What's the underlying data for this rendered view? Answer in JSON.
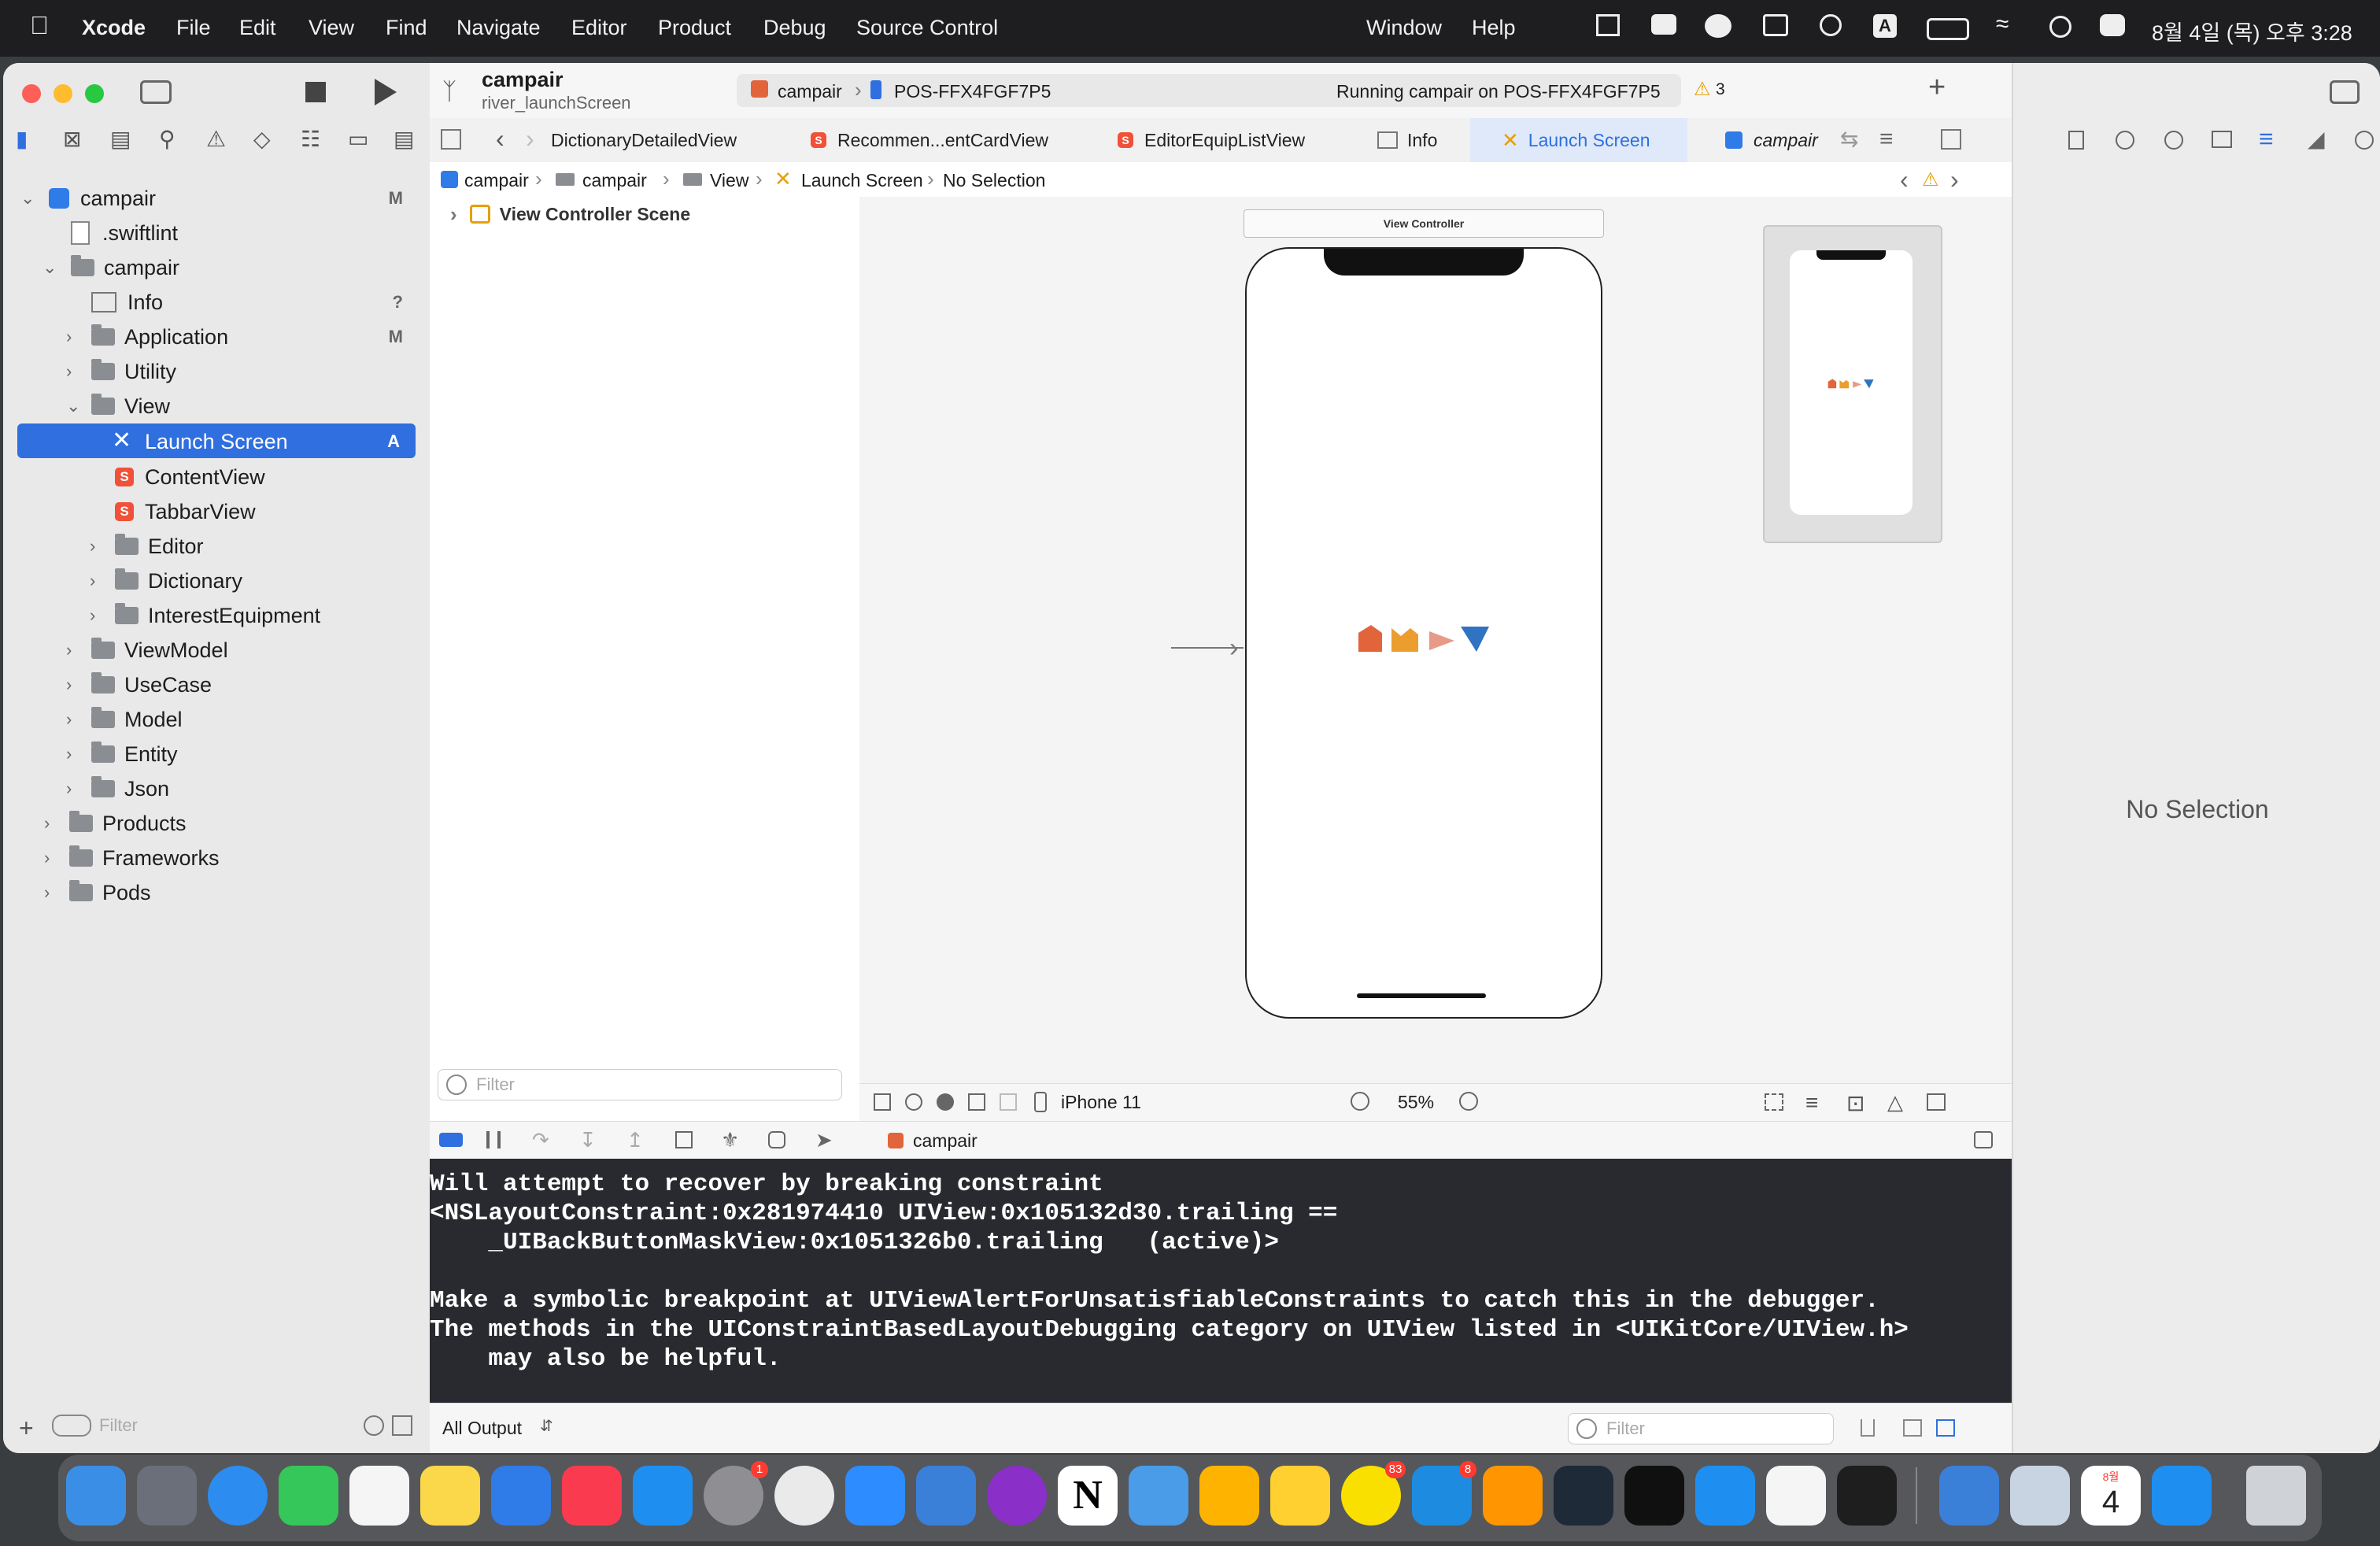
{
  "menubar": {
    "app": "Xcode",
    "items": [
      "File",
      "Edit",
      "View",
      "Find",
      "Navigate",
      "Editor",
      "Product",
      "Debug",
      "Source Control",
      "Window",
      "Help"
    ],
    "clock": "8월 4일 (목) 오후 3:28"
  },
  "toolbar": {
    "project": "campair",
    "branch": "river_launchScreen",
    "scheme": "campair",
    "device": "POS-FFX4FGF7P5",
    "status": "Running campair on POS-FFX4FGF7P5",
    "warnings": "3"
  },
  "tabs": [
    "DictionaryDetailedView",
    "Recommen...entCardView",
    "EditorEquipListView",
    "Info",
    "Launch Screen",
    "campair"
  ],
  "jumpbar": [
    "campair",
    "campair",
    "View",
    "Launch Screen",
    "No Selection"
  ],
  "navigator": {
    "items": [
      {
        "label": "campair",
        "badge": "M"
      },
      {
        "label": ".swiftlint",
        "badge": ""
      },
      {
        "label": "campair",
        "badge": ""
      },
      {
        "label": "Info",
        "badge": "?"
      },
      {
        "label": "Application",
        "badge": "M"
      },
      {
        "label": "Utility",
        "badge": ""
      },
      {
        "label": "View",
        "badge": ""
      },
      {
        "label": "Launch Screen",
        "badge": "A"
      },
      {
        "label": "ContentView",
        "badge": ""
      },
      {
        "label": "TabbarView",
        "badge": ""
      },
      {
        "label": "Editor",
        "badge": ""
      },
      {
        "label": "Dictionary",
        "badge": ""
      },
      {
        "label": "InterestEquipment",
        "badge": ""
      },
      {
        "label": "ViewModel",
        "badge": ""
      },
      {
        "label": "UseCase",
        "badge": ""
      },
      {
        "label": "Model",
        "badge": ""
      },
      {
        "label": "Entity",
        "badge": ""
      },
      {
        "label": "Json",
        "badge": ""
      },
      {
        "label": "Products",
        "badge": ""
      },
      {
        "label": "Frameworks",
        "badge": ""
      },
      {
        "label": "Pods",
        "badge": ""
      }
    ],
    "filter_placeholder": "Filter"
  },
  "outline": {
    "scene": "View Controller Scene",
    "filter_placeholder": "Filter"
  },
  "canvas": {
    "vc_label": "View Controller",
    "device": "iPhone 11",
    "zoom": "55%"
  },
  "inspector": {
    "empty": "No Selection"
  },
  "debugbar": {
    "target": "campair"
  },
  "console": {
    "lines": [
      "Will attempt to recover by breaking constraint",
      "<NSLayoutConstraint:0x281974410 UIView:0x105132d30.trailing ==",
      "    _UIBackButtonMaskView:0x1051326b0.trailing   (active)>",
      "",
      "Make a symbolic breakpoint at UIViewAlertForUnsatisfiableConstraints to catch this in the debugger.",
      "The methods in the UIConstraintBasedLayoutDebugging category on UIView listed in <UIKitCore/UIView.h>",
      "    may also be helpful."
    ],
    "output_selector": "All Output",
    "filter_placeholder": "Filter"
  },
  "dock": {
    "badges": {
      "settings": "1",
      "kakaotalk": "83",
      "notes": "8"
    },
    "calendar_month": "8월",
    "calendar_day": "4"
  },
  "colors": {
    "selection": "#2f6fe0",
    "console_bg": "#292a30",
    "logo": [
      "#e2643b",
      "#eb9d2e",
      "#e79a86",
      "#2f73c2"
    ]
  }
}
